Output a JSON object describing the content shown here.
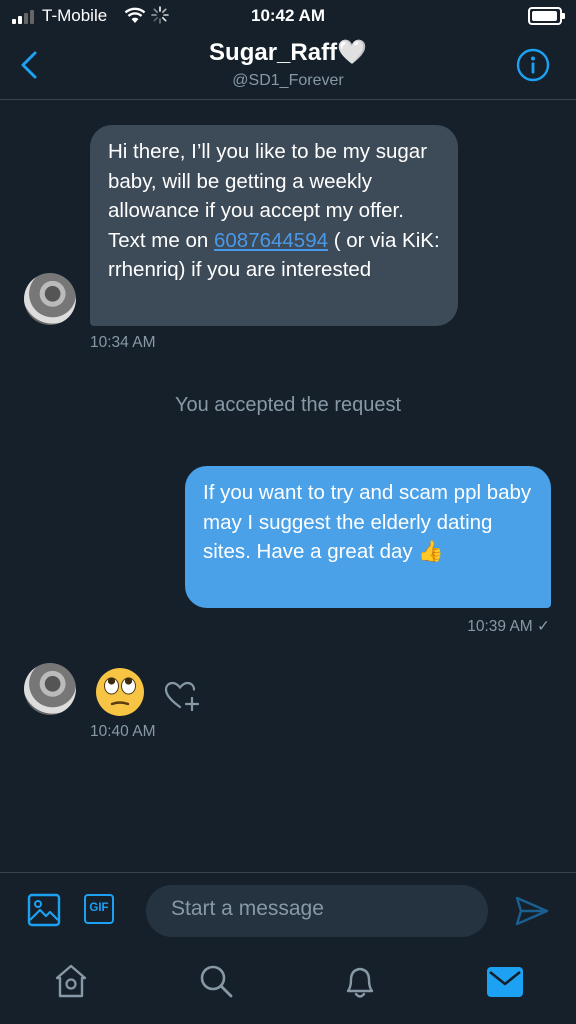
{
  "status_bar": {
    "carrier": "T-Mobile",
    "time": "10:42 AM",
    "battery_level": 0.95
  },
  "header": {
    "name": "Sugar_Raff🤍",
    "handle": "@SD1_Forever"
  },
  "messages": [
    {
      "text_1": "Hi there, I’ll you like  to be my sugar baby, will be getting a weekly allowance if you accept my offer. Text me on",
      "link": "6087644594",
      "text_2": " ( or via KiK: rrhenriq) if you are interested",
      "time": "10:34 AM"
    },
    {
      "system_text": "You accepted the request"
    },
    {
      "text": "If you want to try and scam ppl baby may I suggest the elderly dating sites. Have a great day 👍",
      "time": "10:39 AM ✓"
    },
    {
      "emoji": "🙄",
      "time": "10:40 AM"
    }
  ],
  "composer": {
    "placeholder": "Start a message",
    "gif_label": "GIF"
  },
  "tabs": [
    "home",
    "search",
    "notifications",
    "messages"
  ],
  "colors": {
    "background": "#15202b",
    "accent": "#1da1f2",
    "bubble_in": "#3d4a57",
    "bubble_out": "#4aa1e8"
  }
}
